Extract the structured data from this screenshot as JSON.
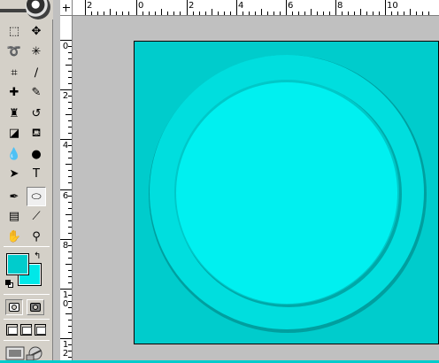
{
  "toolbox": {
    "tools": [
      {
        "name": "marquee-tool",
        "icon": "dashed-rectangle-icon",
        "glyph": "⬚"
      },
      {
        "name": "move-tool",
        "icon": "move-arrow-icon",
        "glyph": "✥"
      },
      {
        "name": "lasso-tool",
        "icon": "lasso-icon",
        "glyph": "➰"
      },
      {
        "name": "magic-wand-tool",
        "icon": "magic-wand-icon",
        "glyph": "✳"
      },
      {
        "name": "crop-tool",
        "icon": "crop-icon",
        "glyph": "⌗"
      },
      {
        "name": "slice-tool",
        "icon": "slice-knife-icon",
        "glyph": "∕"
      },
      {
        "name": "healing-brush-tool",
        "icon": "bandage-icon",
        "glyph": "✚"
      },
      {
        "name": "brush-tool",
        "icon": "brush-icon",
        "glyph": "✎"
      },
      {
        "name": "clone-stamp-tool",
        "icon": "stamp-icon",
        "glyph": "♜"
      },
      {
        "name": "history-brush-tool",
        "icon": "history-brush-icon",
        "glyph": "↺"
      },
      {
        "name": "eraser-tool",
        "icon": "eraser-icon",
        "glyph": "◪"
      },
      {
        "name": "paint-bucket-tool",
        "icon": "paint-bucket-icon",
        "glyph": "⛾"
      },
      {
        "name": "blur-tool",
        "icon": "water-drop-icon",
        "glyph": "💧"
      },
      {
        "name": "dodge-tool",
        "icon": "dodge-icon",
        "glyph": "●"
      },
      {
        "name": "path-selection-tool",
        "icon": "arrow-pointer-icon",
        "glyph": "➤"
      },
      {
        "name": "type-tool",
        "icon": "type-t-icon",
        "glyph": "T"
      },
      {
        "name": "pen-tool",
        "icon": "pen-nib-icon",
        "glyph": "✒"
      },
      {
        "name": "ellipse-tool",
        "icon": "ellipse-icon",
        "glyph": "⬭"
      },
      {
        "name": "notes-tool",
        "icon": "note-icon",
        "glyph": "▤"
      },
      {
        "name": "eyedropper-tool",
        "icon": "eyedropper-icon",
        "glyph": "⟋"
      },
      {
        "name": "hand-tool",
        "icon": "hand-icon",
        "glyph": "✋"
      },
      {
        "name": "zoom-tool",
        "icon": "magnifier-icon",
        "glyph": "⚲"
      }
    ],
    "foreground_color": "#00cccc",
    "background_color": "#00e8e8",
    "swap_glyph": "↰"
  },
  "rulers": {
    "horizontal_labels": [
      "2",
      "0",
      "2",
      "4",
      "6",
      "8",
      "10"
    ],
    "vertical_labels": [
      "0",
      "2",
      "4",
      "6",
      "8",
      "1\n0",
      "1\n2"
    ]
  },
  "canvas": {
    "background": "#00cccc",
    "outer_ring_color": "#00dede",
    "inner_disc_color": "#00f0f0",
    "ring_shadow_color": "#007878"
  }
}
